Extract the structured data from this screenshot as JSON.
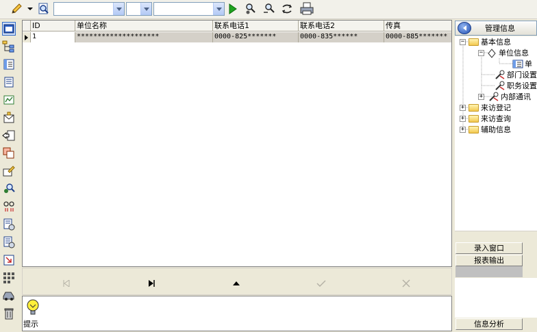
{
  "toolbar": {
    "combo1_value": "",
    "combo2_value": "",
    "combo3_value": ""
  },
  "grid": {
    "columns": [
      "ID",
      "单位名称",
      "联系电话1",
      "联系电话2",
      "传真"
    ],
    "rows": [
      [
        "1",
        "********************",
        "0000-825*******",
        "0000-835******",
        "0000-885*******"
      ]
    ]
  },
  "hint": {
    "label": "提示"
  },
  "right_panel": {
    "title": "管理信息",
    "tree": [
      {
        "label": "基本信息"
      },
      {
        "label": "单位信息"
      },
      {
        "label": "单"
      },
      {
        "label": "部门设置"
      },
      {
        "label": "职务设置"
      },
      {
        "label": "内部通讯"
      },
      {
        "label": "来访登记"
      },
      {
        "label": "来访查询"
      },
      {
        "label": "辅助信息"
      }
    ],
    "buttons": {
      "entry_window": "录入窗口",
      "report_output": "报表输出",
      "info_analysis": "信息分析"
    }
  },
  "colors": {
    "grid_selected_row": "#d4d0c8",
    "toolbar_bg": "#f2f1ea",
    "combo_border": "#7f9db9",
    "run_green": "#1fa31f"
  },
  "icons": {
    "toolbar": [
      "pencil-icon",
      "dropdown-arrow-icon",
      "search-preview-icon",
      "run-icon",
      "find-icon",
      "find-next-icon",
      "refresh-icon",
      "print-icon"
    ],
    "left": [
      "window-icon",
      "tree-icon",
      "list-icon",
      "document-icon",
      "chart-icon",
      "mail-icon",
      "export-icon",
      "copy-icon",
      "edit-icon",
      "user-search-icon",
      "link-icon",
      "doc-settings-icon",
      "doc-list-icon",
      "import-icon",
      "grid-icon",
      "car-icon",
      "trash-icon"
    ],
    "navigator": [
      "first-record-icon",
      "last-record-icon",
      "insert-icon",
      "post-icon",
      "cancel-icon"
    ]
  }
}
